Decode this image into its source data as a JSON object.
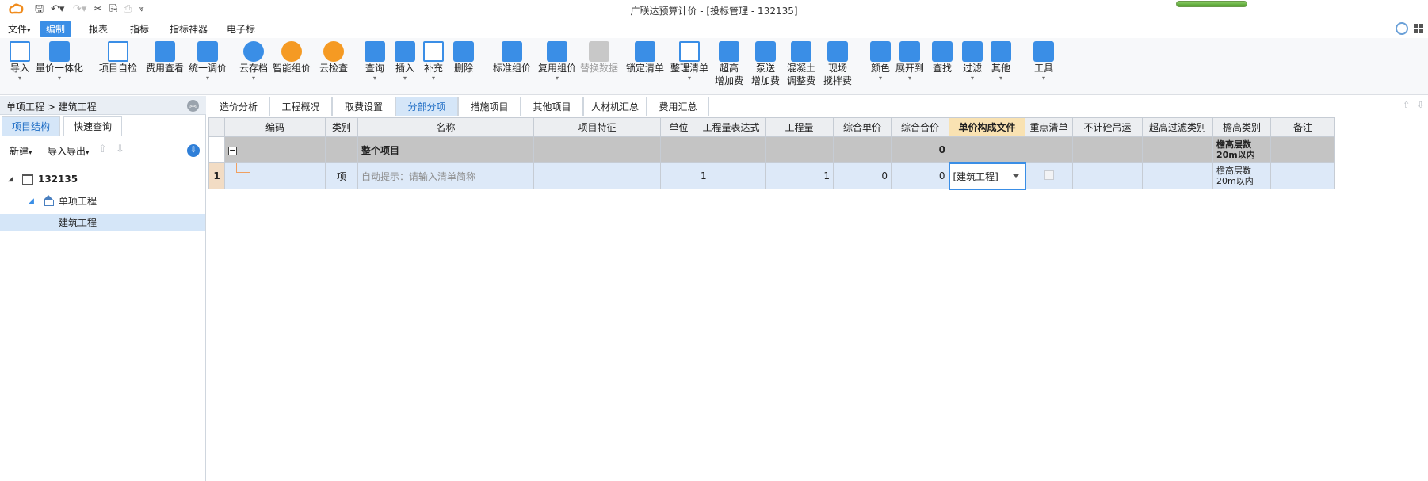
{
  "window": {
    "title": "广联达预算计价 - [投标管理 - 132135]"
  },
  "menu": {
    "items": [
      {
        "label": "文件",
        "suffix": "▾"
      },
      {
        "label": "编制",
        "active": true
      },
      {
        "label": "报表"
      },
      {
        "label": "指标"
      },
      {
        "label": "指标神器"
      },
      {
        "label": "电子标"
      }
    ]
  },
  "toolbar": {
    "import": "导入",
    "price_integration": "量价一体化",
    "self_check": "项目自检",
    "fee_view": "费用查看",
    "unified_price": "统一调价",
    "cloud_save": "云存档",
    "smart_price": "智能组价",
    "cloud_check": "云检查",
    "query": "查询",
    "insert": "插入",
    "supplement": "补充",
    "delete": "删除",
    "standard_price": "标准组价",
    "reuse_price": "复用组价",
    "replace_data": "替换数据",
    "lock_list": "锁定清单",
    "organize_list": "整理清单",
    "super_high_1": "超高",
    "super_high_2": "增加费",
    "pump_1": "泵送",
    "pump_2": "增加费",
    "concrete_1": "混凝土",
    "concrete_2": "调整费",
    "site_1": "现场",
    "site_2": "搅拌费",
    "color": "颜色",
    "expand_to": "展开到",
    "find": "查找",
    "filter": "过滤",
    "other": "其他",
    "tools": "工具"
  },
  "left_panel": {
    "breadcrumb": "单项工程 > 建筑工程",
    "tabs": [
      "项目结构",
      "快速查询"
    ],
    "new_label": "新建",
    "import_export_label": "导入导出",
    "tree": {
      "root": "132135",
      "child": "单项工程",
      "leaf": "建筑工程"
    }
  },
  "main_tabs": [
    "造价分析",
    "工程概况",
    "取费设置",
    "分部分项",
    "措施项目",
    "其他项目",
    "人材机汇总",
    "费用汇总"
  ],
  "active_tab": "分部分项",
  "table": {
    "headers": [
      "编码",
      "类别",
      "名称",
      "项目特征",
      "单位",
      "工程量表达式",
      "工程量",
      "综合单价",
      "综合合价",
      "单价构成文件",
      "重点清单",
      "不计砼吊运",
      "超高过滤类别",
      "檐高类别",
      "备注"
    ],
    "total_row": {
      "name": "整个项目",
      "total_price": "0",
      "eave_category": "檐高层数20m以内"
    },
    "rows": [
      {
        "index": "1",
        "category": "项",
        "name_placeholder": "自动提示：请输入清单简称",
        "quantity_expr": "1",
        "quantity": "1",
        "unit_price": "0",
        "total_price": "0",
        "price_file": "[建筑工程]",
        "eave_category": "檐高层数20m以内"
      }
    ]
  },
  "colors": {
    "accent": "#3a8ee6",
    "highlight_header": "#f9e2b2",
    "total_row": "#c4c4c4",
    "item_row": "#dde9f8"
  }
}
